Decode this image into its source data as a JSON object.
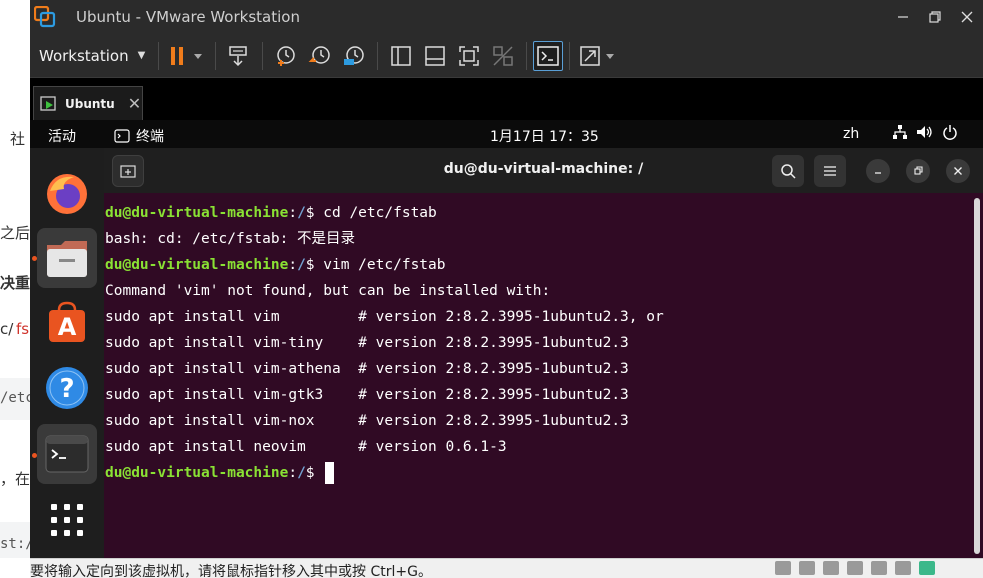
{
  "background_page": {
    "fragments": [
      {
        "text": "社",
        "style": "plain"
      },
      {
        "text": "之后",
        "style": "plain"
      },
      {
        "text": "决重",
        "style": "bold"
      },
      {
        "text": "c/",
        "style": "plain"
      },
      {
        "text": "fs",
        "style": "red"
      },
      {
        "text": "/etc",
        "style": "code"
      },
      {
        "text": "，在",
        "style": "plain"
      },
      {
        "text": "st:/",
        "style": "code"
      }
    ]
  },
  "window": {
    "title": "Ubuntu - VMware Workstation",
    "controls": [
      "minimize-icon",
      "restore-icon",
      "close-icon"
    ]
  },
  "toolbar": {
    "workstation_menu": "Workstation",
    "buttons": [
      {
        "name": "pause-button",
        "icon": "pause-icon"
      },
      {
        "name": "send-ctrl-alt-del-button",
        "icon": "keyboard-send-icon"
      },
      {
        "name": "take-snapshot-button",
        "icon": "snapshot-take-icon"
      },
      {
        "name": "revert-snapshot-button",
        "icon": "snapshot-revert-icon"
      },
      {
        "name": "snapshot-manager-button",
        "icon": "snapshot-manager-icon"
      },
      {
        "name": "show-library-button",
        "icon": "library-panel-icon"
      },
      {
        "name": "thumbnail-bar-button",
        "icon": "thumbnail-bar-icon"
      },
      {
        "name": "full-screen-button",
        "icon": "fullscreen-icon"
      },
      {
        "name": "unity-button",
        "icon": "unity-icon"
      },
      {
        "name": "console-view-button",
        "icon": "console-icon"
      },
      {
        "name": "stretch-guest-button",
        "icon": "stretch-icon"
      }
    ]
  },
  "tabs": [
    {
      "label": "Ubuntu",
      "active": true
    }
  ],
  "gnome": {
    "activities": "活动",
    "app_name": "终端",
    "clock": "1月17日  17：35",
    "input_method": "zh",
    "tray_icons": [
      "network-icon",
      "volume-icon",
      "power-icon"
    ],
    "dock_items": [
      {
        "name": "firefox",
        "icon": "firefox-icon",
        "running": false
      },
      {
        "name": "files",
        "icon": "files-icon",
        "running": true
      },
      {
        "name": "ubuntu-software",
        "icon": "software-icon",
        "running": false
      },
      {
        "name": "help",
        "icon": "help-icon",
        "running": false
      },
      {
        "name": "terminal",
        "icon": "terminal-icon",
        "running": true
      },
      {
        "name": "show-apps",
        "icon": "app-grid-icon",
        "running": false
      }
    ]
  },
  "terminal": {
    "title": "du@du-virtual-machine: /",
    "prompt_user": "du@du-virtual-machine",
    "prompt_sep": ":",
    "prompt_path": "/",
    "prompt_symbol": "$ ",
    "lines": [
      {
        "type": "prompt",
        "cmd": "cd /etc/fstab"
      },
      {
        "type": "output",
        "text": "bash: cd: /etc/fstab: 不是目录"
      },
      {
        "type": "prompt",
        "cmd": "vim /etc/fstab"
      },
      {
        "type": "output",
        "text": "Command 'vim' not found, but can be installed with:"
      },
      {
        "type": "output",
        "text": "sudo apt install vim         # version 2:8.2.3995-1ubuntu2.3, or"
      },
      {
        "type": "output",
        "text": "sudo apt install vim-tiny    # version 2:8.2.3995-1ubuntu2.3"
      },
      {
        "type": "output",
        "text": "sudo apt install vim-athena  # version 2:8.2.3995-1ubuntu2.3"
      },
      {
        "type": "output",
        "text": "sudo apt install vim-gtk3    # version 2:8.2.3995-1ubuntu2.3"
      },
      {
        "type": "output",
        "text": "sudo apt install vim-nox     # version 2:8.2.3995-1ubuntu2.3"
      },
      {
        "type": "output",
        "text": "sudo apt install neovim      # version 0.6.1-3"
      },
      {
        "type": "prompt",
        "cmd": "",
        "cursor": true
      }
    ]
  },
  "status_bar": {
    "message": "要将输入定向到该虚拟机，请将鼠标指针移入其中或按 Ctrl+G。"
  },
  "colors": {
    "terminal_bg": "#300a24",
    "prompt_user": "#8ae234",
    "prompt_path": "#729fcf",
    "ubuntu_orange": "#e95420",
    "vmware_pause": "#f07c1b",
    "active_outline": "#5a9fd6"
  }
}
